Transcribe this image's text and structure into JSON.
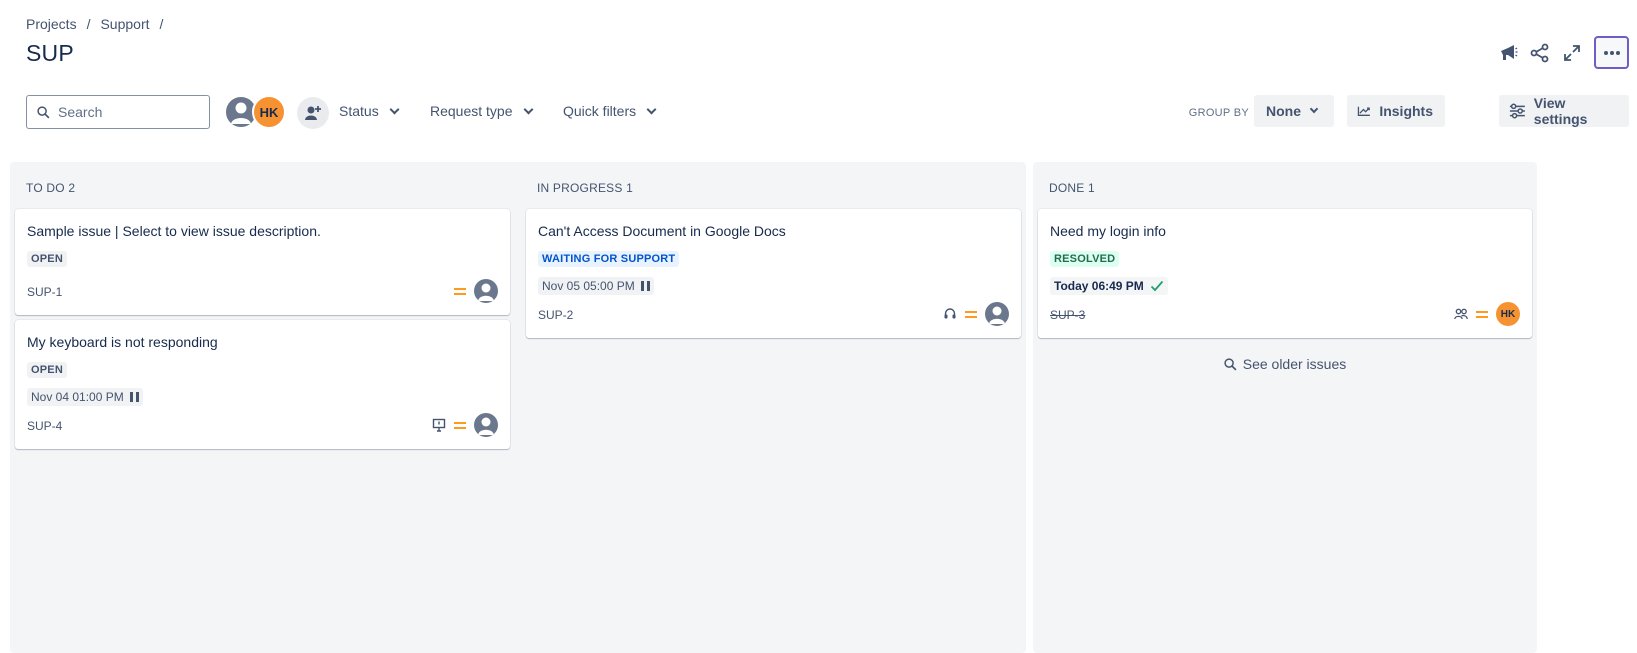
{
  "breadcrumb": {
    "items": [
      "Projects",
      "Support"
    ],
    "separator": "/"
  },
  "page": {
    "title": "SUP"
  },
  "toolbar": {
    "search_placeholder": "Search",
    "avatar_initials": "HK",
    "filters": [
      "Status",
      "Request type",
      "Quick filters"
    ],
    "group_by_label": "GROUP BY",
    "group_by_value": "None",
    "insights_label": "Insights",
    "view_settings_label": "View settings"
  },
  "colors": {
    "accent_purple": "#6e5dc6",
    "priority_medium": "#ff991f",
    "avatar_hk": "#f79232",
    "lozenge_blue": "#0055cc",
    "lozenge_green": "#216e4e"
  },
  "columns": [
    {
      "title": "TO DO 2",
      "cards": [
        {
          "title": "Sample issue | Select to view issue description.",
          "status": "OPEN",
          "key": "SUP-1",
          "priority": "medium",
          "assignee": "unassigned"
        },
        {
          "title": "My keyboard is not responding",
          "status": "OPEN",
          "sla": "Nov 04 01:00 PM",
          "sla_state": "paused",
          "key": "SUP-4",
          "request_type_icon": "computer-support-icon",
          "priority": "medium",
          "assignee": "unassigned"
        }
      ]
    },
    {
      "title": "IN PROGRESS 1",
      "cards": [
        {
          "title": "Can't Access Document in Google Docs",
          "status": "WAITING FOR SUPPORT",
          "sla": "Nov 05 05:00 PM",
          "sla_state": "paused",
          "key": "SUP-2",
          "request_type_icon": "headset-icon",
          "priority": "medium",
          "assignee": "unassigned"
        }
      ]
    },
    {
      "title": "DONE 1",
      "cards": [
        {
          "title": "Need my login info",
          "status": "RESOLVED",
          "sla": "Today 06:49 PM",
          "sla_state": "met",
          "key": "SUP-3",
          "request_type_icon": "people-icon",
          "priority": "medium",
          "assignee": "HK"
        }
      ],
      "footer": "See older issues"
    }
  ]
}
